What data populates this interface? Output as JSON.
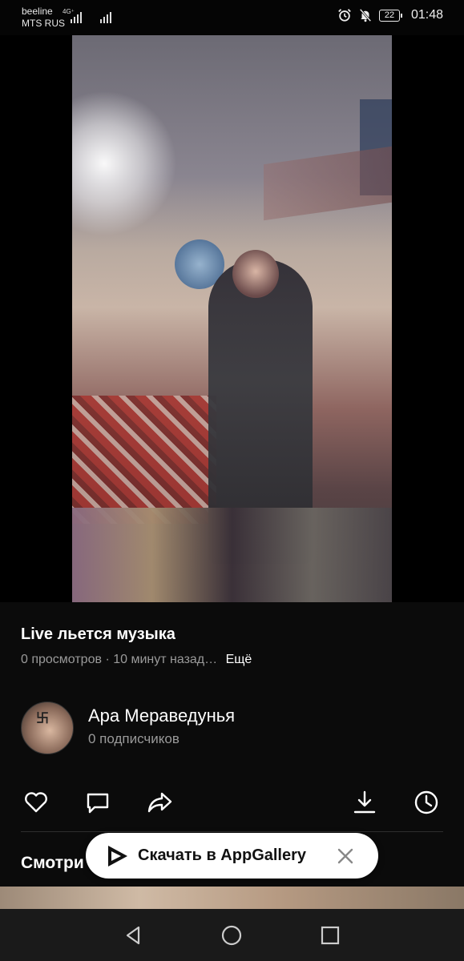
{
  "status_bar": {
    "carrier_1": "beeline",
    "carrier_2": "MTS RUS",
    "network_badge": "4G⁺",
    "battery": "22",
    "time": "01:48",
    "icons": [
      "signal-icon",
      "alarm-icon",
      "mute-icon",
      "battery-icon"
    ]
  },
  "video": {
    "title": "Live льется музыка",
    "views": "0 просмотров",
    "separator": "·",
    "time_ago": "10 минут назад…",
    "more_label": "Ещё"
  },
  "channel": {
    "name": "Ара Мераведунья",
    "subscribers": "0 подписчиков",
    "avatar_mark": "卐"
  },
  "actions": {
    "items": [
      "like-icon",
      "comment-icon",
      "share-icon",
      "download-icon",
      "watch-later-icon"
    ]
  },
  "section": {
    "watch_heading": "Смотри"
  },
  "toast": {
    "label": "Скачать в AppGallery"
  },
  "colors": {
    "background": "#0b0b0b",
    "secondary_text": "#9a9a9a",
    "toast_bg": "#ffffff"
  }
}
